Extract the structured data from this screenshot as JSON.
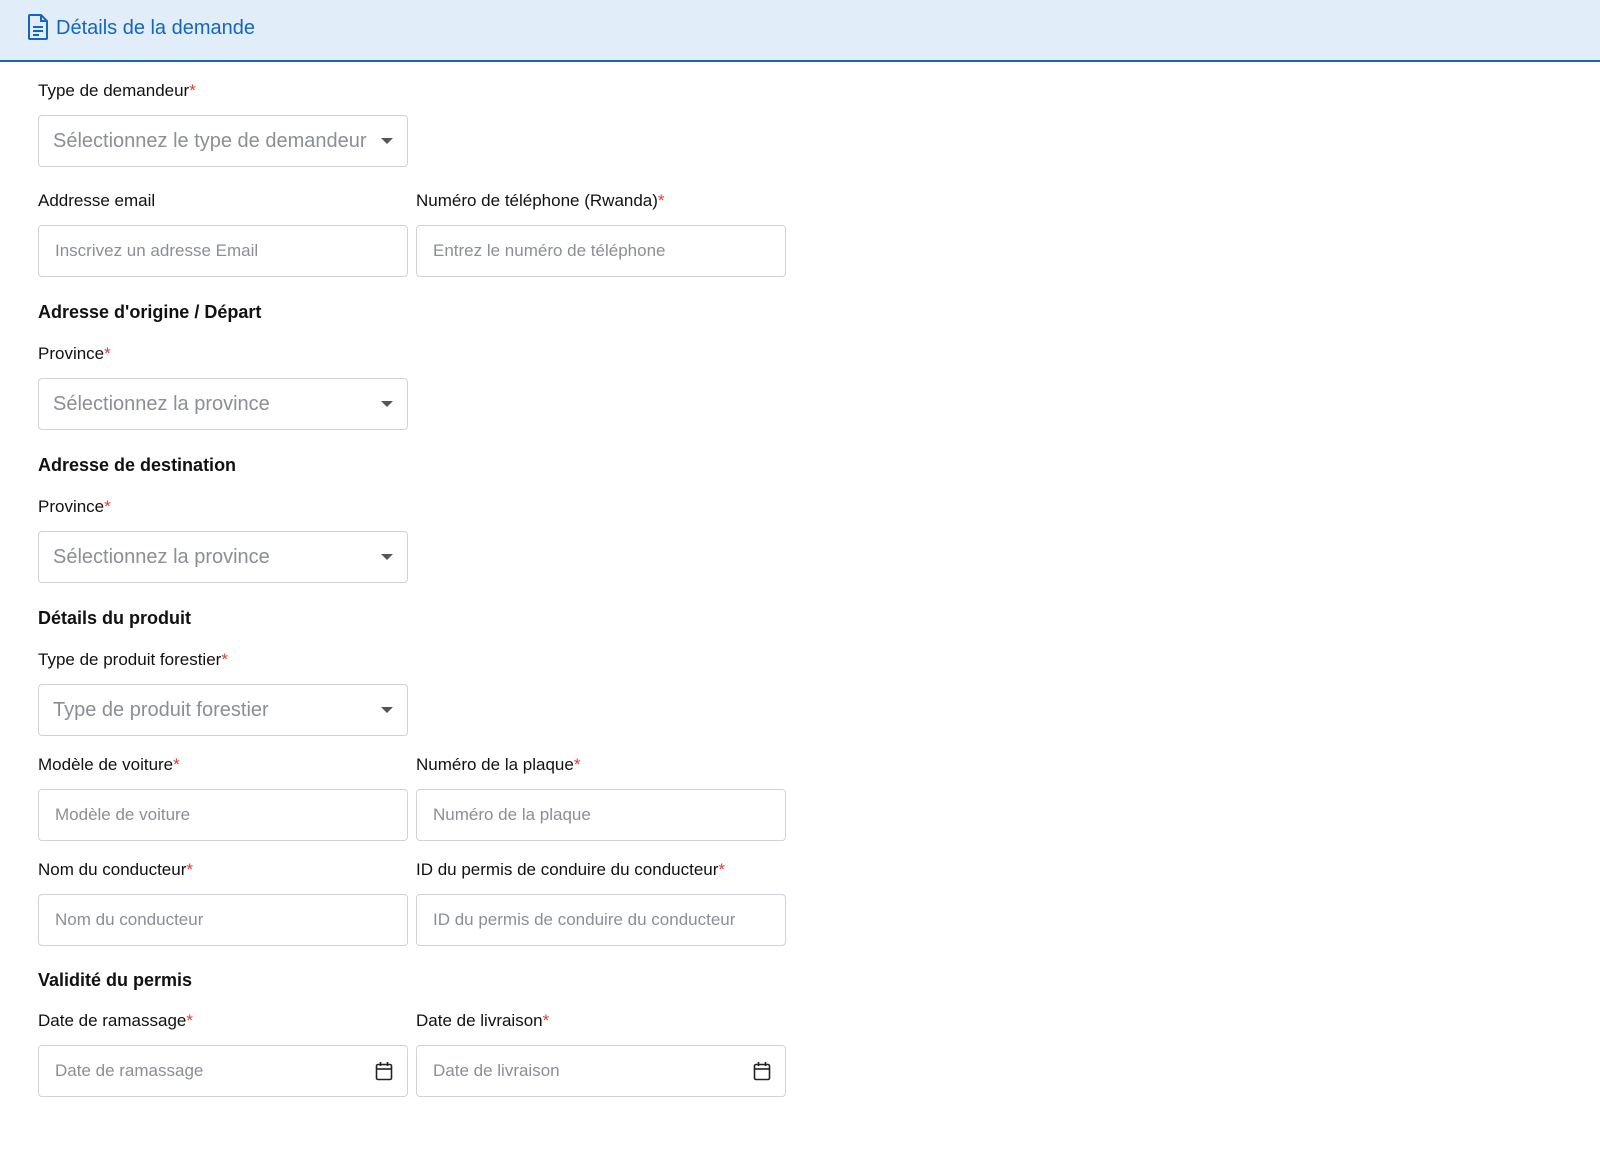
{
  "header": {
    "title": "Détails de la demande",
    "icon": "document-icon",
    "accent": "#1565c0"
  },
  "form": {
    "requester_type": {
      "label": "Type de demandeur",
      "placeholder": "Sélectionnez le type de demandeur"
    },
    "email": {
      "label": "Addresse email",
      "placeholder": "Inscrivez un adresse Email"
    },
    "phone": {
      "label": "Numéro de téléphone (Rwanda)",
      "placeholder": "Entrez le numéro de téléphone"
    },
    "origin": {
      "section": "Adresse d'origine / Départ",
      "province_label": "Province",
      "province_placeholder": "Sélectionnez la province"
    },
    "destination": {
      "section": "Adresse de destination",
      "province_label": "Province",
      "province_placeholder": "Sélectionnez la province"
    },
    "product": {
      "section": "Détails du produit",
      "type_label": "Type de produit forestier",
      "type_placeholder": "Type de produit forestier",
      "car_model_label": "Modèle de voiture",
      "car_model_placeholder": "Modèle de voiture",
      "plate_label": "Numéro de la plaque",
      "plate_placeholder": "Numéro de la plaque",
      "driver_name_label": "Nom du conducteur",
      "driver_name_placeholder": "Nom du conducteur",
      "license_label": "ID du permis de conduire du conducteur",
      "license_placeholder": "ID du permis de conduire du conducteur"
    },
    "validity": {
      "section": "Validité du permis",
      "pickup_label": "Date de ramassage",
      "pickup_placeholder": "Date de ramassage",
      "delivery_label": "Date de livraison",
      "delivery_placeholder": "Date de livraison"
    },
    "required_mark": "*"
  }
}
